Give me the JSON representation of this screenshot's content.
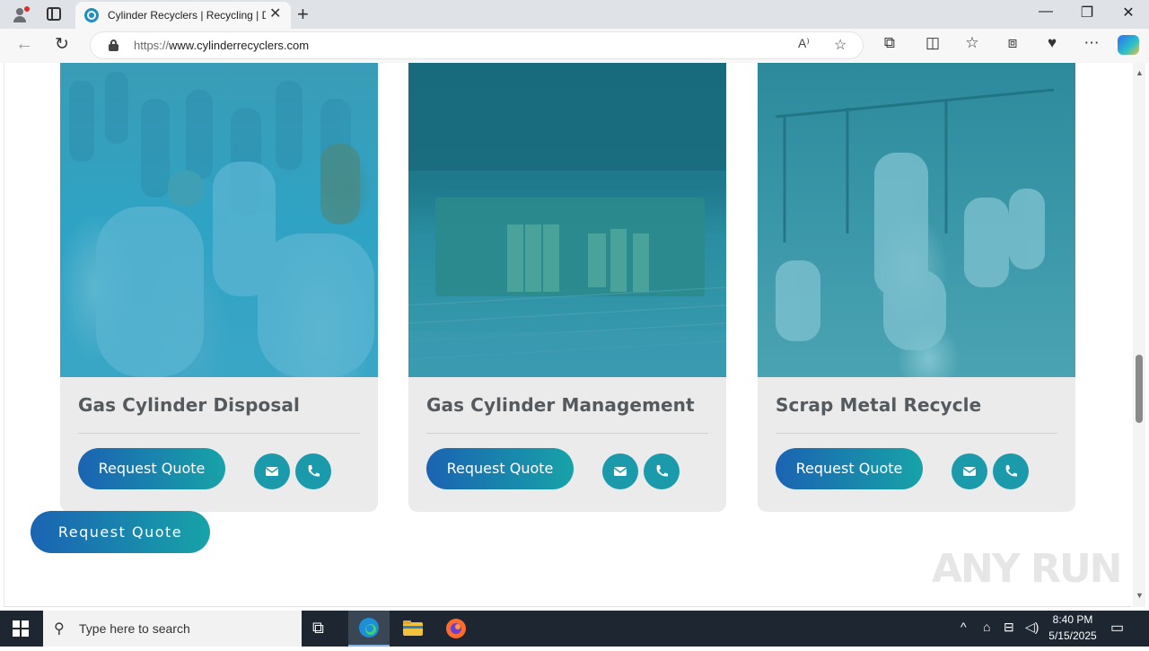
{
  "browser": {
    "tab_title": "Cylinder Recyclers | Recycling | D",
    "url_proto": "https://",
    "url_host": "www.cylinderrecyclers.com"
  },
  "cards": [
    {
      "title": "Gas Cylinder Disposal",
      "button": "Request Quote"
    },
    {
      "title": "Gas Cylinder Management",
      "button": "Request Quote"
    },
    {
      "title": "Scrap Metal Recycle",
      "button": "Request Quote"
    }
  ],
  "floating_button": "Request Quote",
  "watermark": "ANY RUN",
  "taskbar": {
    "search_placeholder": "Type here to search",
    "time": "8:40 PM",
    "date": "5/15/2025"
  },
  "colors": {
    "accent_blue": "#1b63b2",
    "accent_teal": "#17a3a8",
    "card_bg": "#ebebeb",
    "title_text": "#555a5e"
  },
  "icons": [
    "mail-icon",
    "phone-icon",
    "lock-icon",
    "refresh-icon",
    "back-icon",
    "star-icon",
    "windows-start-icon",
    "search-icon"
  ]
}
